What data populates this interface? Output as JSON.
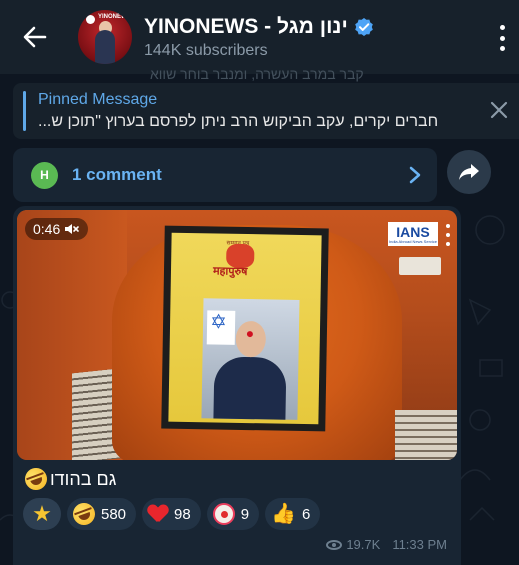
{
  "header": {
    "title": "YINONEWS - ינון מגל",
    "subscribers": "144K subscribers",
    "avatar_brand": "YINONEWS"
  },
  "background_text": "קבר במרב העשרה, ומנבר בוחר שווא",
  "pinned": {
    "label": "Pinned Message",
    "text": "חברים יקרים, עקב הביקוש הרב ניתן לפרסם בערוץ \"תוכן ש..."
  },
  "comments": {
    "avatar_letter": "H",
    "label": "1 comment"
  },
  "message": {
    "video_duration": "0:46",
    "watermark": "IANS",
    "watermark_sub": "India Abroad News Service",
    "poster_title": "महापुरुष",
    "poster_small": "सम्मान पत्र",
    "caption": "גם בהודו",
    "reactions": [
      {
        "icon": "star-icon",
        "count": ""
      },
      {
        "icon": "rolling-laugh-icon",
        "count": "580"
      },
      {
        "icon": "heart-icon",
        "count": "98"
      },
      {
        "icon": "clown-icon",
        "count": "9"
      },
      {
        "icon": "thumbs-up-icon",
        "count": "6"
      }
    ],
    "views": "19.7K",
    "time": "11:33 PM"
  },
  "colors": {
    "accent": "#6ab3f3",
    "pinned_accent": "#5fa8e8",
    "background": "#0e1621",
    "header": "#17212b",
    "bubble": "#182533"
  }
}
